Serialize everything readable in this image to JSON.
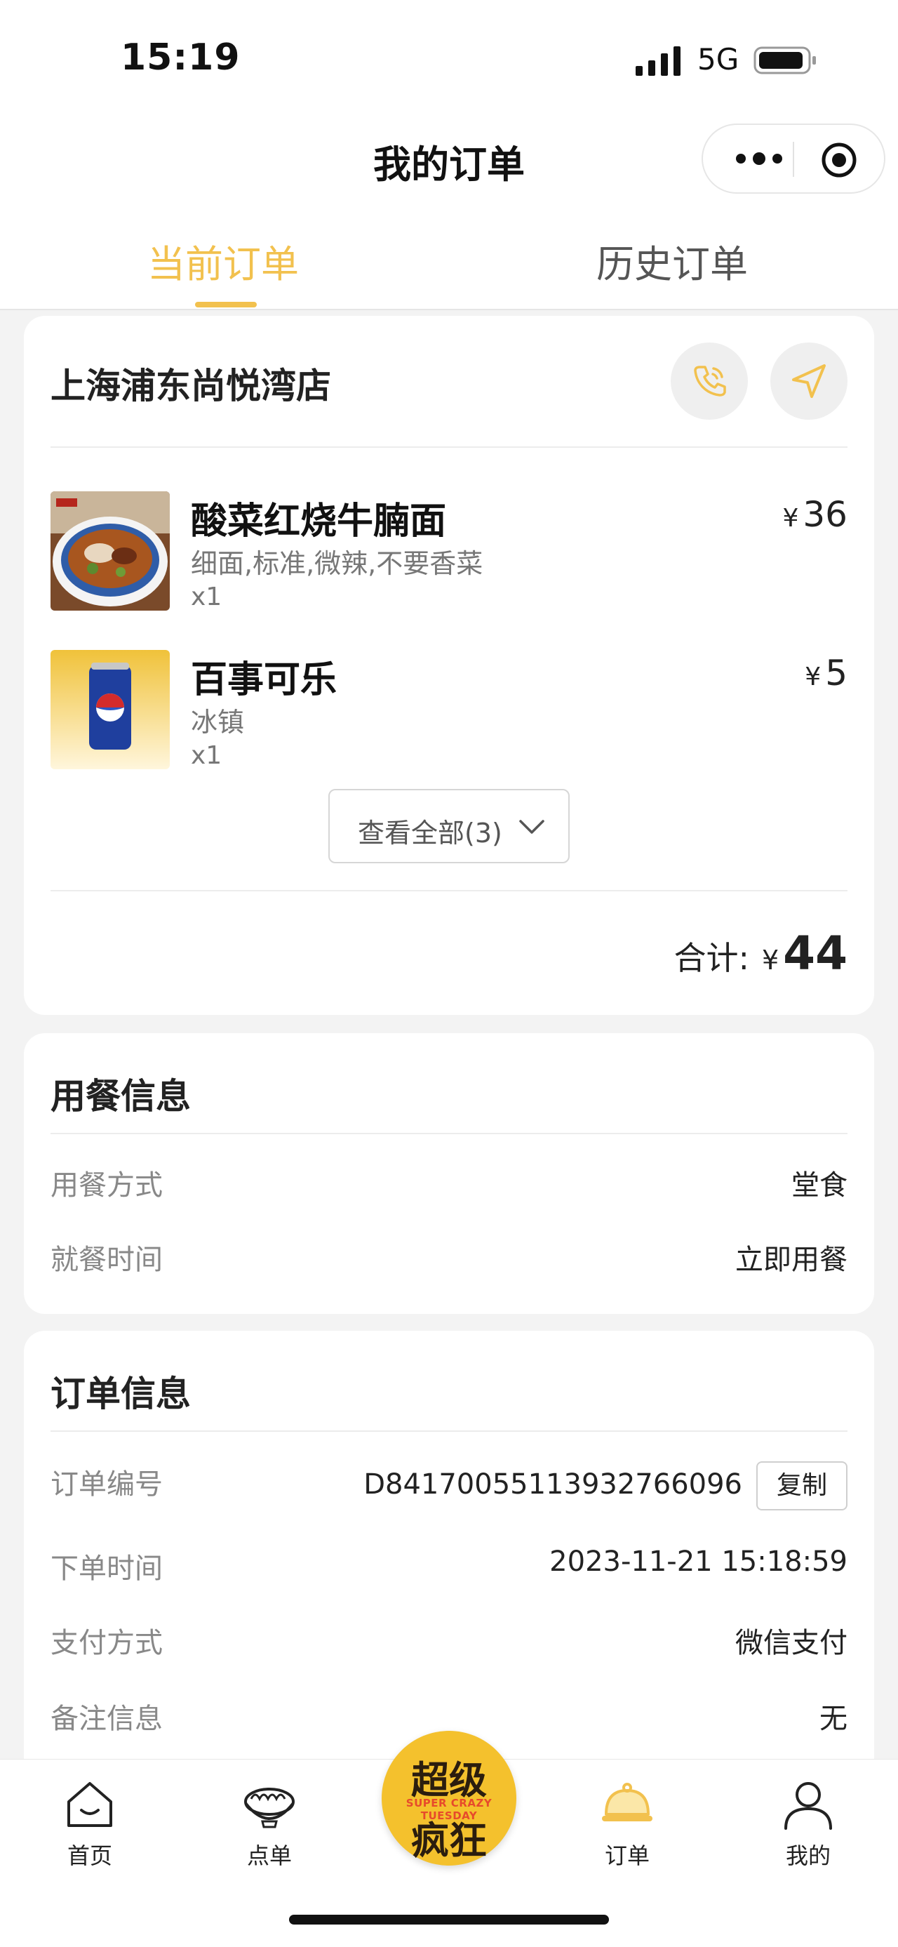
{
  "status_bar": {
    "time": "15:19",
    "network": "5G"
  },
  "header": {
    "title": "我的订单"
  },
  "tabs": [
    {
      "label": "当前订单",
      "active": true
    },
    {
      "label": "历史订单",
      "active": false
    }
  ],
  "order": {
    "store_name": "上海浦东尚悦湾店",
    "items": [
      {
        "name": "酸菜红烧牛腩面",
        "spec": "细面,标准,微辣,不要香菜",
        "qty": "x1",
        "currency": "¥",
        "price": "36"
      },
      {
        "name": "百事可乐",
        "spec": "冰镇",
        "qty": "x1",
        "currency": "¥",
        "price": "5"
      }
    ],
    "view_all_label": "查看全部(3)",
    "total_label": "合计:",
    "total_currency": "¥",
    "total_amount": "44"
  },
  "meal_info": {
    "title": "用餐信息",
    "rows": [
      {
        "label": "用餐方式",
        "value": "堂食"
      },
      {
        "label": "就餐时间",
        "value": "立即用餐"
      }
    ]
  },
  "order_info": {
    "title": "订单信息",
    "rows": [
      {
        "label": "订单编号",
        "value": "D8417005511393276609​6"
      },
      {
        "label": "下单时间",
        "value": "2023-11-21 15:18:59"
      },
      {
        "label": "支付方式",
        "value": "微信支付"
      },
      {
        "label": "备注信息",
        "value": "无"
      }
    ],
    "copy_label": "复制"
  },
  "bottom_nav": [
    {
      "label": "首页",
      "icon": "home-icon"
    },
    {
      "label": "点单",
      "icon": "noodle-bowl-icon"
    },
    {
      "label": "订单",
      "icon": "cloche-icon",
      "active": true
    },
    {
      "label": "我的",
      "icon": "person-icon"
    }
  ],
  "promo": {
    "line1": "超级",
    "line2": "SUPER CRAZY TUESDAY",
    "line3": "疯狂"
  },
  "colors": {
    "accent": "#f2c14e",
    "background": "#f3f3f3",
    "card": "#ffffff",
    "muted_text": "#888888"
  }
}
